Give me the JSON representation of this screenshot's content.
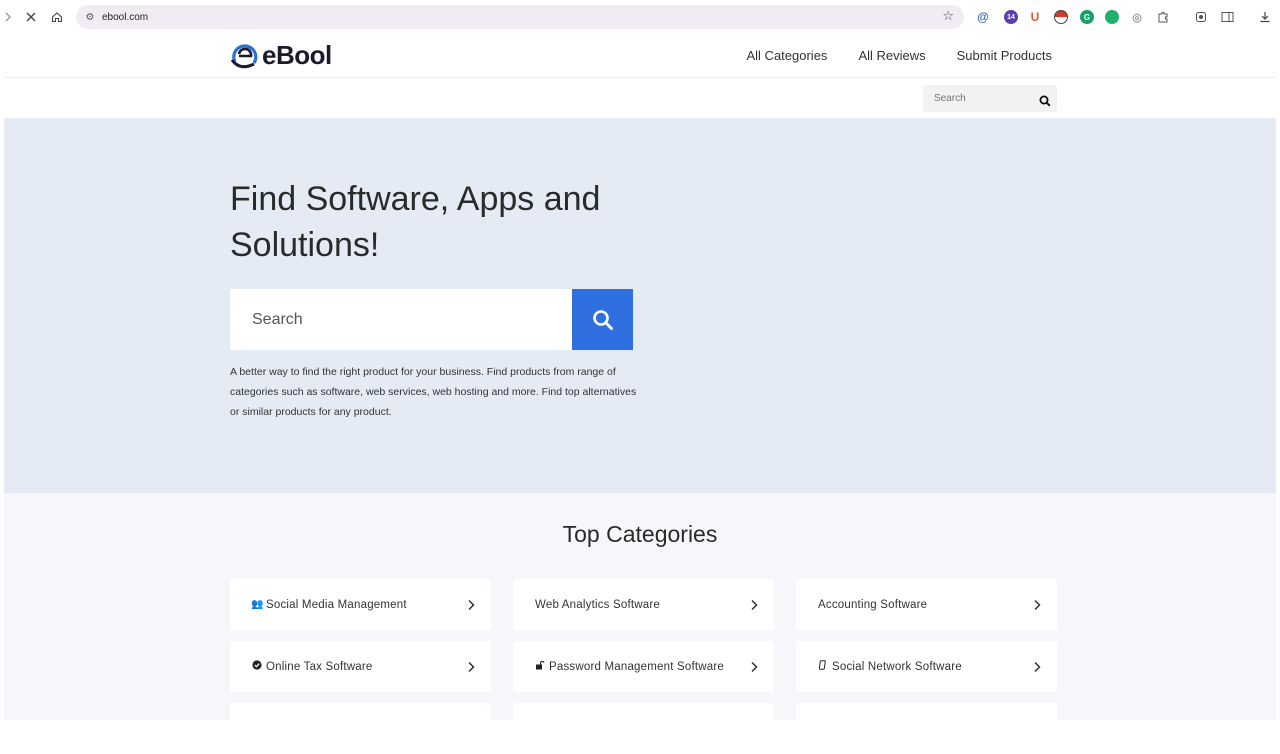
{
  "browser": {
    "url": "ebool.com",
    "nav_icons": [
      "forward-icon",
      "close-icon",
      "home-icon"
    ],
    "extensions": [
      {
        "name": "at-sign-icon",
        "glyph": "@",
        "color": "#3a66c8"
      },
      {
        "name": "extension-badge-icon",
        "glyph": "14",
        "color": "#5b3fb0"
      },
      {
        "name": "u-extension-icon",
        "glyph": "U",
        "color": "#e0572a"
      },
      {
        "name": "pokeball-icon",
        "glyph": "●",
        "color": "#d33a2c"
      },
      {
        "name": "grammarly-icon",
        "glyph": "G",
        "color": "#15a06a"
      },
      {
        "name": "green-extension-icon",
        "glyph": "●",
        "color": "#1fb26b"
      },
      {
        "name": "camera-icon",
        "glyph": "◎",
        "color": "#9a9a9a"
      },
      {
        "name": "puzzle-icon",
        "glyph": "⧉",
        "color": "#555555"
      }
    ]
  },
  "header": {
    "logo_text": "eBool",
    "nav": [
      "All Categories",
      "All Reviews",
      "Submit Products"
    ],
    "search_placeholder": "Search"
  },
  "hero": {
    "title": "Find Software, Apps and Solutions!",
    "search_placeholder": "Search",
    "description": "A better way to find the right product for your business. Find products from range of categories such as software, web services, web hosting and more. Find top alternatives or similar products for any product."
  },
  "categories": {
    "heading": "Top Categories",
    "items": [
      {
        "label": "Social Media Management",
        "icon": "users-icon",
        "glyph": "👥"
      },
      {
        "label": "Web Analytics Software",
        "icon": "",
        "glyph": ""
      },
      {
        "label": "Accounting Software",
        "icon": "",
        "glyph": ""
      },
      {
        "label": "Online Tax Software",
        "icon": "check-circle-icon",
        "glyph": "✔"
      },
      {
        "label": "Password Management Software",
        "icon": "unlock-icon",
        "glyph": "🔓"
      },
      {
        "label": "Social Network Software",
        "icon": "phone-icon",
        "glyph": "▯"
      }
    ]
  },
  "colors": {
    "accent": "#2f6fe0",
    "hero_bg": "#e4ebf5",
    "section_bg": "#f5f7fb"
  }
}
